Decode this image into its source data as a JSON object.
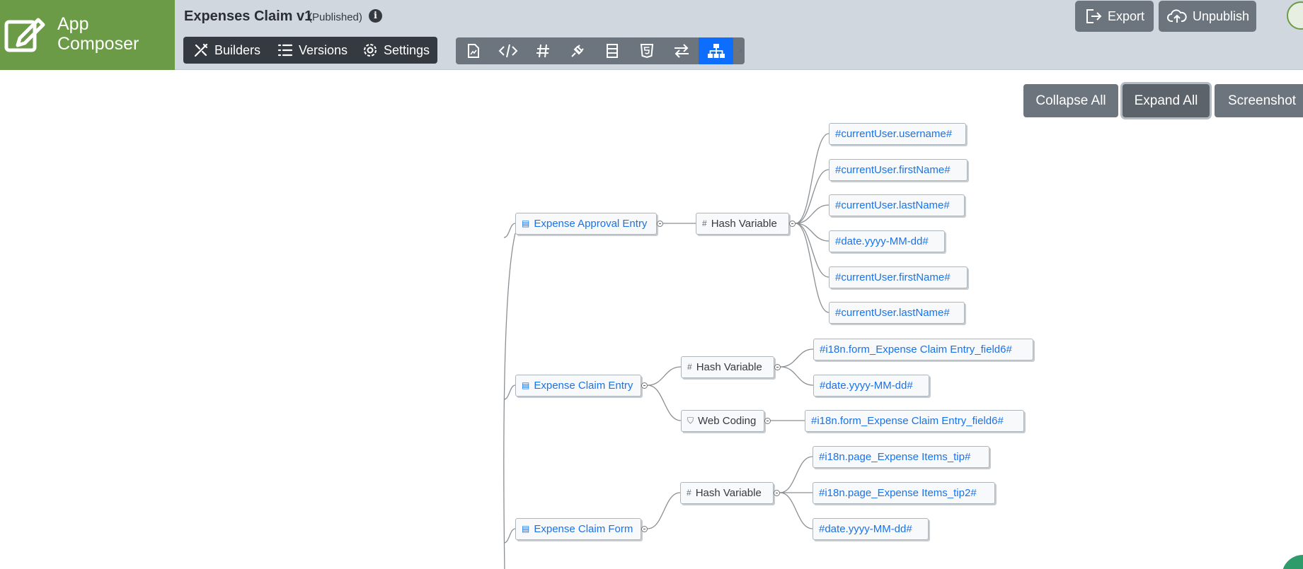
{
  "brand": {
    "line1": "App",
    "line2": "Composer"
  },
  "app": {
    "title": "Expenses Claim v1",
    "status": "(Published)"
  },
  "nav": {
    "builders": "Builders",
    "versions": "Versions",
    "settings": "Settings"
  },
  "toolbar_icons": [
    "chart-icon",
    "code-icon",
    "hash-icon",
    "plug-icon",
    "layout-icon",
    "html5-icon",
    "swap-icon",
    "sitemap-icon"
  ],
  "header_buttons": {
    "export": "Export",
    "unpublish": "Unpublish"
  },
  "actions": {
    "collapse_all": "Collapse All",
    "expand_all": "Expand All",
    "screenshot": "Screenshot"
  },
  "tree": {
    "pages": [
      {
        "label": "Expense Approval Entry",
        "groups": [
          {
            "label": "Hash Variable",
            "type": "hash",
            "items": [
              "#currentUser.username#",
              "#currentUser.firstName#",
              "#currentUser.lastName#",
              "#date.yyyy-MM-dd#",
              "#currentUser.firstName#",
              "#currentUser.lastName#"
            ]
          }
        ]
      },
      {
        "label": "Expense Claim Entry",
        "groups": [
          {
            "label": "Hash Variable",
            "type": "hash",
            "items": [
              "#i18n.form_Expense Claim Entry_field6#",
              "#date.yyyy-MM-dd#"
            ]
          },
          {
            "label": "Web Coding",
            "type": "web",
            "items": [
              "#i18n.form_Expense Claim Entry_field6#"
            ]
          }
        ]
      },
      {
        "label": "Expense Claim Form",
        "groups": [
          {
            "label": "Hash Variable",
            "type": "hash",
            "items": [
              "#i18n.page_Expense Items_tip#",
              "#i18n.page_Expense Items_tip2#",
              "#date.yyyy-MM-dd#"
            ]
          }
        ]
      }
    ]
  },
  "colors": {
    "brand": "#6b9b46",
    "header": "#d0d7df",
    "button": "#6c757d",
    "active": "#0d6efd",
    "link": "#1a73e8"
  }
}
